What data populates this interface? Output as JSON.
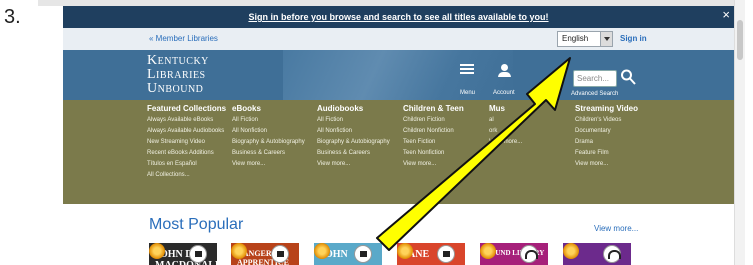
{
  "step_label": "3.",
  "banner": {
    "text": "Sign in before you browse and search to see all titles available to you!",
    "close": "×"
  },
  "utility": {
    "member_link": "« Member Libraries",
    "language": "English",
    "signin": "Sign in"
  },
  "header": {
    "logo_lines": [
      "Kentucky",
      "Libraries",
      "Unbound"
    ],
    "menu_label": "Menu",
    "account_label": "Account",
    "search_placeholder": "Search...",
    "advanced_search": "Advanced Search"
  },
  "nav": {
    "columns": [
      {
        "heading": "Featured Collections",
        "links": [
          "Always Available eBooks",
          "Always Available Audiobooks",
          "New Streaming Video",
          "Recent eBooks Additions",
          "Títulos en Español",
          "All Collections..."
        ]
      },
      {
        "heading": "eBooks",
        "links": [
          "All Fiction",
          "All Nonfiction",
          "Biography & Autobiography",
          "Business & Careers",
          "View more..."
        ]
      },
      {
        "heading": "Audiobooks",
        "links": [
          "All Fiction",
          "All Nonfiction",
          "Biography & Autobiography",
          "Business & Careers",
          "View more..."
        ]
      },
      {
        "heading": "Children & Teen",
        "links": [
          "Children Fiction",
          "Children Nonfiction",
          "Teen Fiction",
          "Teen Nonfiction",
          "View more..."
        ]
      },
      {
        "heading": "Mus",
        "links": [
          "",
          "",
          "al",
          "ork",
          "View more..."
        ]
      },
      {
        "heading": "Streaming Video",
        "links": [
          "Children's Videos",
          "Documentary",
          "Drama",
          "Feature Film",
          "View more..."
        ]
      }
    ]
  },
  "popular": {
    "title": "Most Popular",
    "view_more": "View more...",
    "covers": [
      {
        "title": "JOHN D. MACDONALD",
        "color": "#2b2b2b",
        "format": "book"
      },
      {
        "title": "RANGER'S APPRENTICE",
        "color": "#b8431a",
        "format": "book"
      },
      {
        "title": "JOHN",
        "color": "#5aa9c9",
        "format": "book"
      },
      {
        "title": "JANE",
        "color": "#d9452b",
        "format": "book"
      },
      {
        "title": "SOUND LIBRARY",
        "color": "#a6207a",
        "format": "audio"
      },
      {
        "title": "",
        "color": "#6c2a8c",
        "format": "audio"
      }
    ]
  },
  "colors": {
    "banner": "#1f3f5f",
    "header": "#3f6f97",
    "nav": "#7b7a4b",
    "link": "#2a6ebb",
    "arrow_fill": "#ffff00",
    "arrow_outline": "#111111"
  }
}
